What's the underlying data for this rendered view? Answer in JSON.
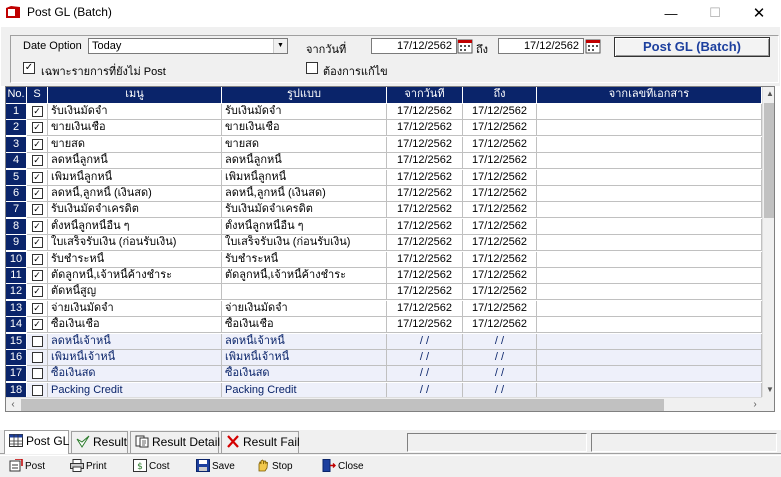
{
  "window": {
    "title": "Post GL (Batch)"
  },
  "filter": {
    "date_option_label": "Date Option",
    "date_option_value": "Today",
    "from_date_label": "จากวันที่",
    "from_date": "17/12/2562",
    "to_label": "ถึง",
    "to_date": "17/12/2562",
    "only_unposted_label": "เฉพาะรายการที่ยังไม่ Post",
    "only_unposted_checked": "✓",
    "need_edit_label": "ต้องการแก้ไข",
    "post_button": "Post GL (Batch)"
  },
  "grid": {
    "columns": [
      "No.",
      "S",
      "เมนู",
      "รูปแบบ",
      "จากวันที่",
      "ถึง",
      "จากเลขที่เอกสาร"
    ],
    "rows": [
      {
        "no": "1",
        "s": "✓",
        "menu": "รับเงินมัดจำ",
        "format": "รับเงินมัดจำ",
        "from": "17/12/2562",
        "to": "17/12/2562"
      },
      {
        "no": "2",
        "s": "✓",
        "menu": "ขายเงินเชื่อ",
        "format": "ขายเงินเชื่อ",
        "from": "17/12/2562",
        "to": "17/12/2562"
      },
      {
        "no": "3",
        "s": "✓",
        "menu": "ขายสด",
        "format": "ขายสด",
        "from": "17/12/2562",
        "to": "17/12/2562"
      },
      {
        "no": "4",
        "s": "✓",
        "menu": "ลดหนี้ลูกหนี้",
        "format": "ลดหนี้ลูกหนี้",
        "from": "17/12/2562",
        "to": "17/12/2562"
      },
      {
        "no": "5",
        "s": "✓",
        "menu": "เพิ่มหนี้ลูกหนี้",
        "format": "เพิ่มหนี้ลูกหนี้",
        "from": "17/12/2562",
        "to": "17/12/2562"
      },
      {
        "no": "6",
        "s": "✓",
        "menu": "ลดหนี้,ลูกหนี้ (เงินสด)",
        "format": "ลดหนี้,ลูกหนี้ (เงินสด)",
        "from": "17/12/2562",
        "to": "17/12/2562"
      },
      {
        "no": "7",
        "s": "✓",
        "menu": "รับเงินมัดจำเครดิต",
        "format": "รับเงินมัดจำเครดิต",
        "from": "17/12/2562",
        "to": "17/12/2562"
      },
      {
        "no": "8",
        "s": "✓",
        "menu": "ตั้งหนี้ลูกหนี้อื่น ๆ",
        "format": "ตั้งหนี้ลูกหนี้อื่น ๆ",
        "from": "17/12/2562",
        "to": "17/12/2562"
      },
      {
        "no": "9",
        "s": "✓",
        "menu": "ใบเสร็จรับเงิน (ก่อนรับเงิน)",
        "format": "ใบเสร็จรับเงิน (ก่อนรับเงิน)",
        "from": "17/12/2562",
        "to": "17/12/2562"
      },
      {
        "no": "10",
        "s": "✓",
        "menu": "รับชำระหนี้",
        "format": "รับชำระหนี้",
        "from": "17/12/2562",
        "to": "17/12/2562"
      },
      {
        "no": "11",
        "s": "✓",
        "menu": "ตัดลูกหนี้,เจ้าหนี้ค้างชำระ",
        "format": "ตัดลูกหนี้,เจ้าหนี้ค้างชำระ",
        "from": "17/12/2562",
        "to": "17/12/2562"
      },
      {
        "no": "12",
        "s": "✓",
        "menu": "ตัดหนี้สูญ",
        "format": "",
        "from": "17/12/2562",
        "to": "17/12/2562"
      },
      {
        "no": "13",
        "s": "✓",
        "menu": "จ่ายเงินมัดจำ",
        "format": "จ่ายเงินมัดจำ",
        "from": "17/12/2562",
        "to": "17/12/2562"
      },
      {
        "no": "14",
        "s": "✓",
        "menu": "ซื้อเงินเชื่อ",
        "format": "ซื้อเงินเชื่อ",
        "from": "17/12/2562",
        "to": "17/12/2562"
      },
      {
        "no": "15",
        "s": "",
        "menu": "ลดหนี้เจ้าหนี้",
        "format": "ลดหนี้เจ้าหนี้",
        "from": "/ /",
        "to": "/ /"
      },
      {
        "no": "16",
        "s": "",
        "menu": "เพิ่มหนี้เจ้าหนี้",
        "format": "เพิ่มหนี้เจ้าหนี้",
        "from": "/ /",
        "to": "/ /"
      },
      {
        "no": "17",
        "s": "",
        "menu": "ซื้อเงินสด",
        "format": "ซื้อเงินสด",
        "from": "/ /",
        "to": "/ /"
      },
      {
        "no": "18",
        "s": "",
        "menu": "Packing Credit",
        "format": "Packing Credit",
        "from": "/ /",
        "to": "/ /"
      }
    ]
  },
  "tabs": [
    "Post GL",
    "Result",
    "Result Detail",
    "Result Fail"
  ],
  "toolbar": {
    "post": "Post",
    "print": "Print",
    "cost": "Cost",
    "save": "Save",
    "stop": "Stop",
    "close": "Close"
  },
  "colors": {
    "header_bg": "#0a246a",
    "accent_text": "#1c3f9e",
    "close_x": "#d40000"
  }
}
